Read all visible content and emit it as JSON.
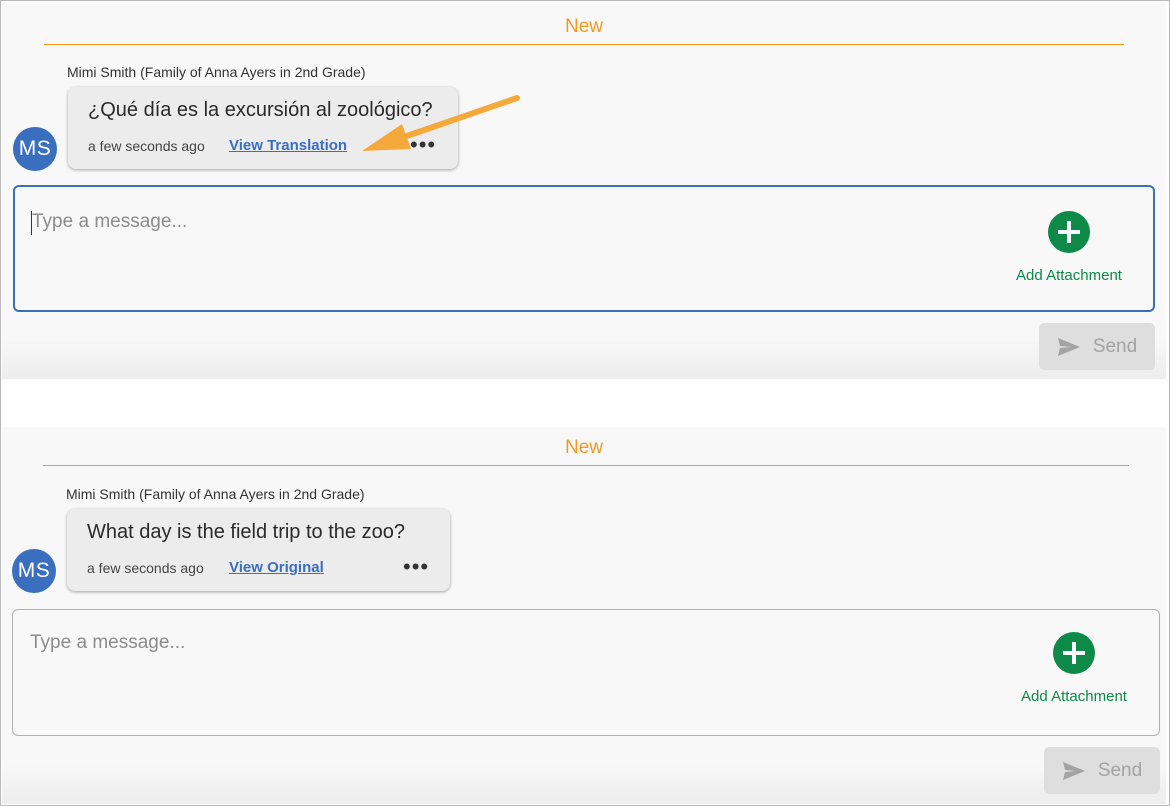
{
  "top_panel": {
    "divider_label": "New",
    "sender": "Mimi Smith (Family of Anna Ayers in 2nd Grade)",
    "avatar_initials": "MS",
    "message": "¿Qué día es la excursión al zoológico?",
    "timestamp": "a few seconds ago",
    "link": "View Translation",
    "more": "•••",
    "composer": {
      "placeholder": "Type a message..."
    },
    "attach_label": "Add Attachment",
    "send_label": "Send"
  },
  "bottom_panel": {
    "divider_label": "New",
    "sender": "Mimi Smith (Family of Anna Ayers in 2nd Grade)",
    "avatar_initials": "MS",
    "message": "What day is the field trip to the zoo?",
    "timestamp": "a few seconds ago",
    "link": "View Original",
    "more": "•••",
    "composer": {
      "placeholder": "Type a message..."
    },
    "attach_label": "Add Attachment",
    "send_label": "Send"
  },
  "colors": {
    "accent_orange": "#f39a1e",
    "avatar_blue": "#3a6fc0",
    "attach_green": "#0d8a47",
    "focus_border": "#3d6fb8"
  },
  "icons": {
    "more": "more-options-icon",
    "attach": "plus-icon",
    "send": "paper-plane-icon",
    "annotation": "arrow-annotation-icon"
  }
}
